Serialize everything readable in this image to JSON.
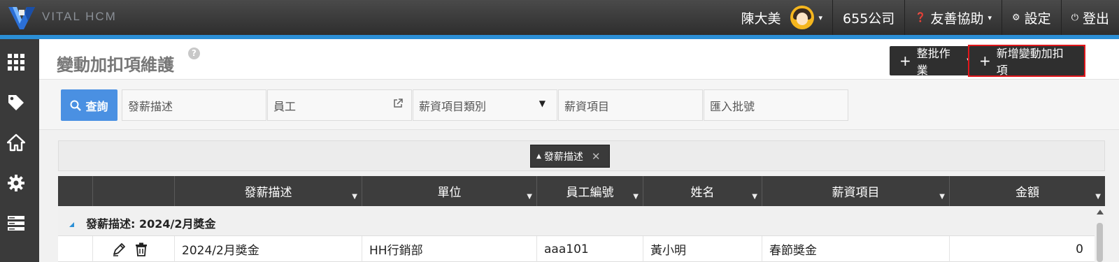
{
  "app": {
    "brand": "VITAL HCM",
    "logo_letter": "V"
  },
  "topbar": {
    "user_name": "陳大美",
    "company": "655公司",
    "help_label": "友善協助",
    "settings_label": "設定",
    "logout_label": "登出"
  },
  "sidebar": {
    "items": [
      {
        "icon": "grid-apps-icon"
      },
      {
        "icon": "tag-icon"
      },
      {
        "icon": "home-icon"
      },
      {
        "icon": "gear-icon"
      },
      {
        "icon": "server-list-icon"
      }
    ]
  },
  "page": {
    "title": "變動加扣項維護",
    "help_glyph": "?",
    "batch_button": "整批作業",
    "new_button": "新增變動加扣項"
  },
  "filters": {
    "search_button": "查詢",
    "payroll_desc_placeholder": "發薪描述",
    "employee_placeholder": "員工",
    "salary_category_placeholder": "薪資項目類別",
    "salary_item_placeholder": "薪資項目",
    "import_batch_placeholder": "匯入批號"
  },
  "group_panel": {
    "chip_label": "發薪描述",
    "chip_close": "✕"
  },
  "grid": {
    "columns": [
      "發薪描述",
      "單位",
      "員工編號",
      "姓名",
      "薪資項目",
      "金額"
    ],
    "group_label": "發薪描述: 2024/2月獎金",
    "rows": [
      {
        "payroll_desc": "2024/2月獎金",
        "department": "HH行銷部",
        "emp_no": "aaa101",
        "name": "黃小明",
        "salary_item": "春節獎金",
        "amount": "0"
      }
    ]
  },
  "colors": {
    "accent_blue": "#2b8fd6",
    "search_blue": "#4a90e2",
    "highlight_red": "#e0161b"
  }
}
